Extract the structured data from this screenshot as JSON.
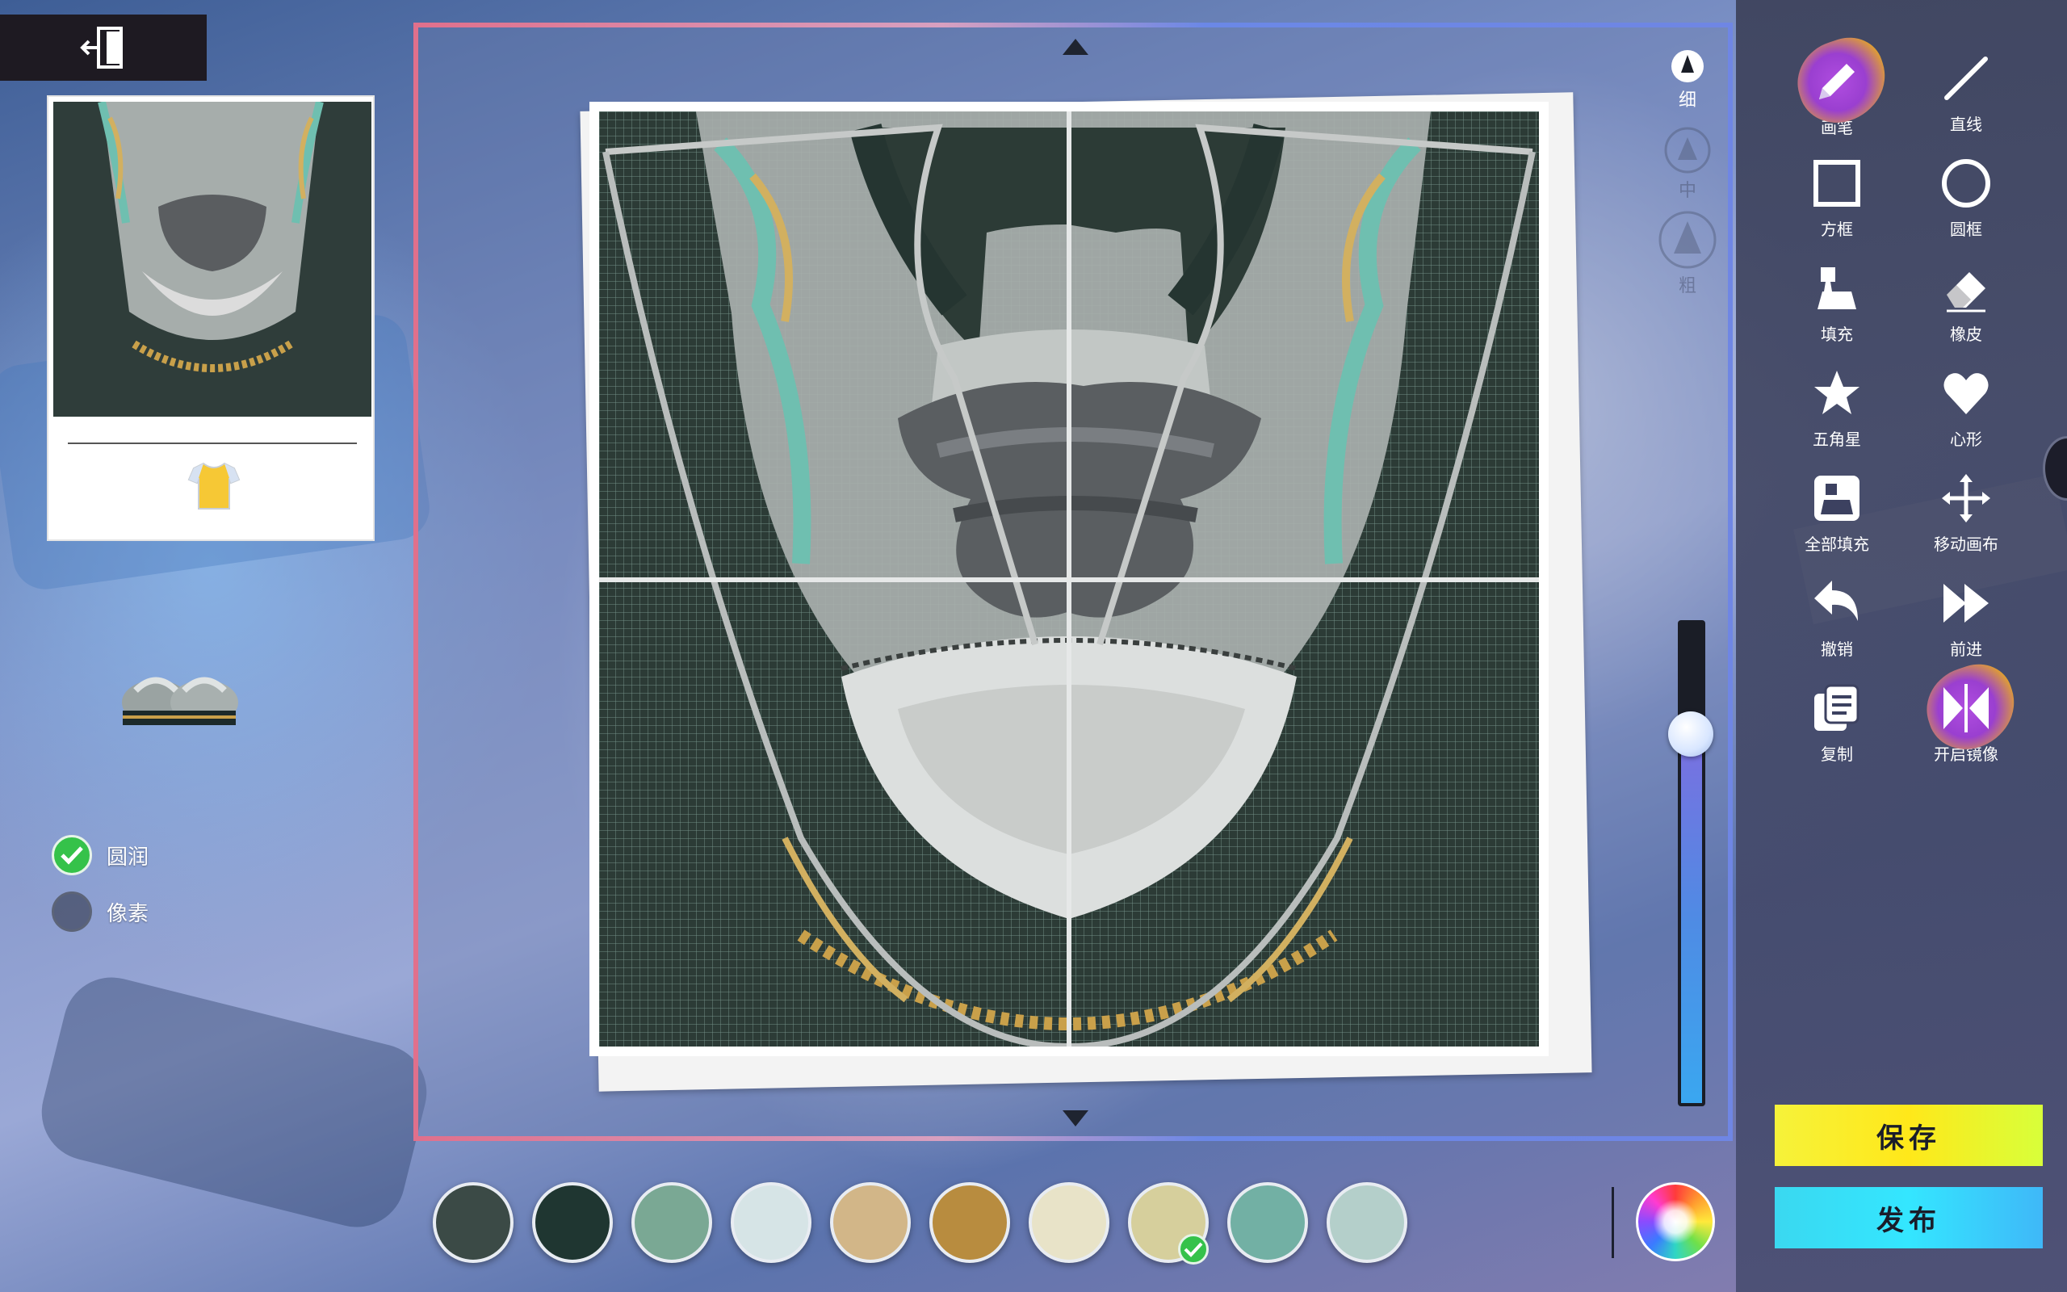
{
  "brush_sizes": [
    {
      "id": "thin",
      "label": "细"
    },
    {
      "id": "medium",
      "label": "中"
    },
    {
      "id": "thick",
      "label": "粗"
    }
  ],
  "render_options": [
    {
      "id": "smooth",
      "label": "圆润",
      "checked": true
    },
    {
      "id": "pixel",
      "label": "像素",
      "checked": false
    }
  ],
  "tools": [
    {
      "id": "pen",
      "label": "画笔",
      "icon": "pencil-icon",
      "active": true
    },
    {
      "id": "line",
      "label": "直线",
      "icon": "line-icon",
      "active": false
    },
    {
      "id": "rect",
      "label": "方框",
      "icon": "square-icon",
      "active": false
    },
    {
      "id": "circle",
      "label": "圆框",
      "icon": "circle-icon",
      "active": false
    },
    {
      "id": "fill",
      "label": "填充",
      "icon": "paint-bucket-icon",
      "active": false
    },
    {
      "id": "eraser",
      "label": "橡皮",
      "icon": "eraser-icon",
      "active": false
    },
    {
      "id": "star",
      "label": "五角星",
      "icon": "star-icon",
      "active": false
    },
    {
      "id": "heart",
      "label": "心形",
      "icon": "heart-icon",
      "active": false
    },
    {
      "id": "fill_all",
      "label": "全部填充",
      "icon": "fill-all-icon",
      "active": false
    },
    {
      "id": "move",
      "label": "移动画布",
      "icon": "move-icon",
      "active": false
    },
    {
      "id": "undo",
      "label": "撤销",
      "icon": "undo-icon",
      "active": false
    },
    {
      "id": "redo",
      "label": "前进",
      "icon": "redo-icon",
      "active": false
    },
    {
      "id": "copy",
      "label": "复制",
      "icon": "copy-icon",
      "active": false
    },
    {
      "id": "mirror",
      "label": "开启镜像",
      "icon": "mirror-icon",
      "active": true
    }
  ],
  "buttons": {
    "save": "保存",
    "publish": "发布"
  },
  "palette": {
    "colors": [
      "#3b4a46",
      "#1f3631",
      "#7aa894",
      "#d6e4e6",
      "#d2b688",
      "#b88c3f",
      "#e8e3c8",
      "#d6cf9c",
      "#72b0a4",
      "#b4cfca"
    ],
    "selected_index": 7
  },
  "brush_size_level": 0.77,
  "colors": {
    "save_bg": "#f6f23a",
    "publish_bg": "#34e6ff",
    "check": "#35c24a",
    "canvas_bg": "#2c3b36"
  }
}
